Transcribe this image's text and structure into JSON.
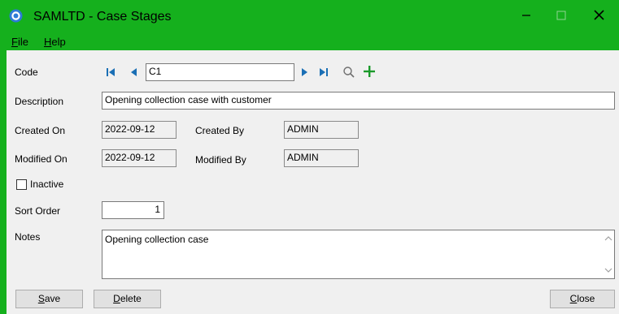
{
  "window": {
    "title": "SAMLTD - Case Stages",
    "min_icon": "minimize-icon",
    "max_icon": "maximize-icon",
    "close_icon": "close-icon"
  },
  "menu": {
    "file": {
      "mnemonic": "F",
      "rest": "ile"
    },
    "help": {
      "mnemonic": "H",
      "rest": "elp"
    }
  },
  "form": {
    "code_label": "Code",
    "code_value": "C1",
    "description_label": "Description",
    "description_value": "Opening collection case with customer",
    "created_on_label": "Created On",
    "created_on_value": "2022-09-12",
    "created_by_label": "Created By",
    "created_by_value": "ADMIN",
    "modified_on_label": "Modified On",
    "modified_on_value": "2022-09-12",
    "modified_by_label": "Modified By",
    "modified_by_value": "ADMIN",
    "inactive_label": "Inactive",
    "inactive_checked": false,
    "sort_order_label": "Sort Order",
    "sort_order_value": "1",
    "notes_label": "Notes",
    "notes_value": "Opening collection case"
  },
  "buttons": {
    "save": {
      "mnemonic": "S",
      "rest": "ave"
    },
    "delete": {
      "mnemonic": "D",
      "rest": "elete"
    },
    "close": {
      "mnemonic": "C",
      "rest": "lose"
    }
  },
  "colors": {
    "titlebar": "#15b01d",
    "nav_arrow": "#1a6fb5",
    "add_icon": "#1a9a2a"
  }
}
